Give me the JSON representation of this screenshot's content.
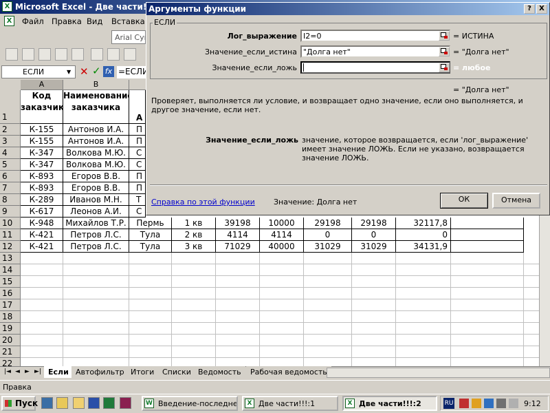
{
  "window": {
    "title": "Microsoft Excel - Две части!!!:2"
  },
  "menu": [
    "Файл",
    "Правка",
    "Вид",
    "Вставка"
  ],
  "toolbar": {
    "font_name": "Arial Cyr"
  },
  "formula_bar": {
    "name_box": "ЕСЛИ",
    "formula": "=ЕСЛИ"
  },
  "columns": [
    "A",
    "B"
  ],
  "table": {
    "header_row": {
      "row": "1",
      "a": "Код заказчика",
      "b": "Наименование заказчика",
      "c": "А"
    },
    "rows": [
      {
        "row": "2",
        "a": "К-155",
        "b": "Антонов И.А.",
        "c": "П"
      },
      {
        "row": "3",
        "a": "К-155",
        "b": "Антонов И.А.",
        "c": "П"
      },
      {
        "row": "4",
        "a": "К-347",
        "b": "Волкова М.Ю.",
        "c": "С"
      },
      {
        "row": "5",
        "a": "К-347",
        "b": "Волкова М.Ю.",
        "c": "С"
      },
      {
        "row": "6",
        "a": "К-893",
        "b": "Егоров В.В.",
        "c": "П"
      },
      {
        "row": "7",
        "a": "К-893",
        "b": "Егоров В.В.",
        "c": "П"
      },
      {
        "row": "8",
        "a": "К-289",
        "b": "Иванов М.Н.",
        "c": "Т"
      },
      {
        "row": "9",
        "a": "К-617",
        "b": "Леонов А.И.",
        "c": "С"
      },
      {
        "row": "10",
        "a": "К-948",
        "b": "Михайлов Т.Р.",
        "c": "Пермь",
        "d": "1 кв",
        "e": "39198",
        "f": "10000",
        "g": "29198",
        "h": "29198",
        "i": "32117,8"
      },
      {
        "row": "11",
        "a": "К-421",
        "b": "Петров Л.С.",
        "c": "Тула",
        "d": "2 кв",
        "e": "4114",
        "f": "4114",
        "g": "0",
        "h": "0",
        "i": "0"
      },
      {
        "row": "12",
        "a": "К-421",
        "b": "Петров Л.С.",
        "c": "Тула",
        "d": "3 кв",
        "e": "71029",
        "f": "40000",
        "g": "31029",
        "h": "31029",
        "i": "34131,9"
      }
    ],
    "empty_rows": [
      "13",
      "14",
      "15",
      "16",
      "17",
      "18",
      "19",
      "20",
      "21",
      "22"
    ]
  },
  "sheet_tabs": [
    "Если",
    "Автофильтр",
    "Итоги",
    "Списки",
    "Ведомость",
    "Рабочая ведомость"
  ],
  "status": "Правка",
  "dialog": {
    "title": "Аргументы функции",
    "help_btn": "?",
    "close_btn": "X",
    "group": "ЕСЛИ",
    "args": [
      {
        "label": "Лог_выражение",
        "value": "I2=0",
        "result": "= ИСТИНА"
      },
      {
        "label": "Значение_если_истина",
        "value": "\"Долга нет\"",
        "result": "= \"Долга нет\""
      },
      {
        "label": "Значение_если_ложь",
        "value": "",
        "result": "= любое"
      }
    ],
    "overall_result": "= \"Долга нет\"",
    "description": "Проверяет, выполняется ли условие, и возвращает одно значение, если оно выполняется, и другое значение, если нет.",
    "arg_help_name": "Значение_если_ложь",
    "arg_help_text": "значение, которое возвращается, если 'лог_выражение' имеет значение ЛОЖЬ. Если не указано, возвращается значение ЛОЖЬ.",
    "help_link": "Справка по этой функции",
    "value_text": "Значение:  Долга нет",
    "ok": "ОК",
    "cancel": "Отмена"
  },
  "taskbar": {
    "start": "Пуск",
    "tasks": [
      "Введение-последне...",
      "Две части!!!:1",
      "Две части!!!:2"
    ],
    "lang": "RU",
    "clock": "9:12"
  }
}
